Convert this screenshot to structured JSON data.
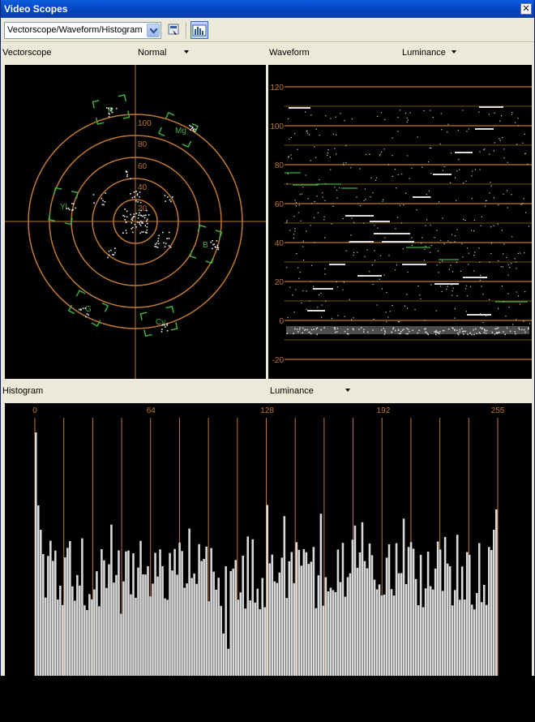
{
  "window": {
    "title": "Video Scopes"
  },
  "toolbar": {
    "scope_select": "Vectorscope/Waveform/Histogram",
    "icons": [
      "dropdown-arrow-icon",
      "eyedropper-icon",
      "histogram-icon"
    ]
  },
  "vectorscope": {
    "label": "Vectorscope",
    "mode": "Normal",
    "ring_labels": [
      "100",
      "80",
      "60",
      "40",
      "20"
    ],
    "targets": [
      "R",
      "Mg",
      "B",
      "Cy",
      "G",
      "Yl"
    ],
    "colors": {
      "grid": "#c07830",
      "target": "#3fae3f"
    }
  },
  "waveform": {
    "label": "Waveform",
    "mode": "Luminance",
    "scale_labels": [
      "120",
      "100",
      "80",
      "60",
      "40",
      "20",
      "0",
      "-20"
    ]
  },
  "histogram": {
    "label": "Histogram",
    "mode": "Luminance",
    "scale_labels": [
      "0",
      "64",
      "128",
      "192",
      "255"
    ]
  }
}
